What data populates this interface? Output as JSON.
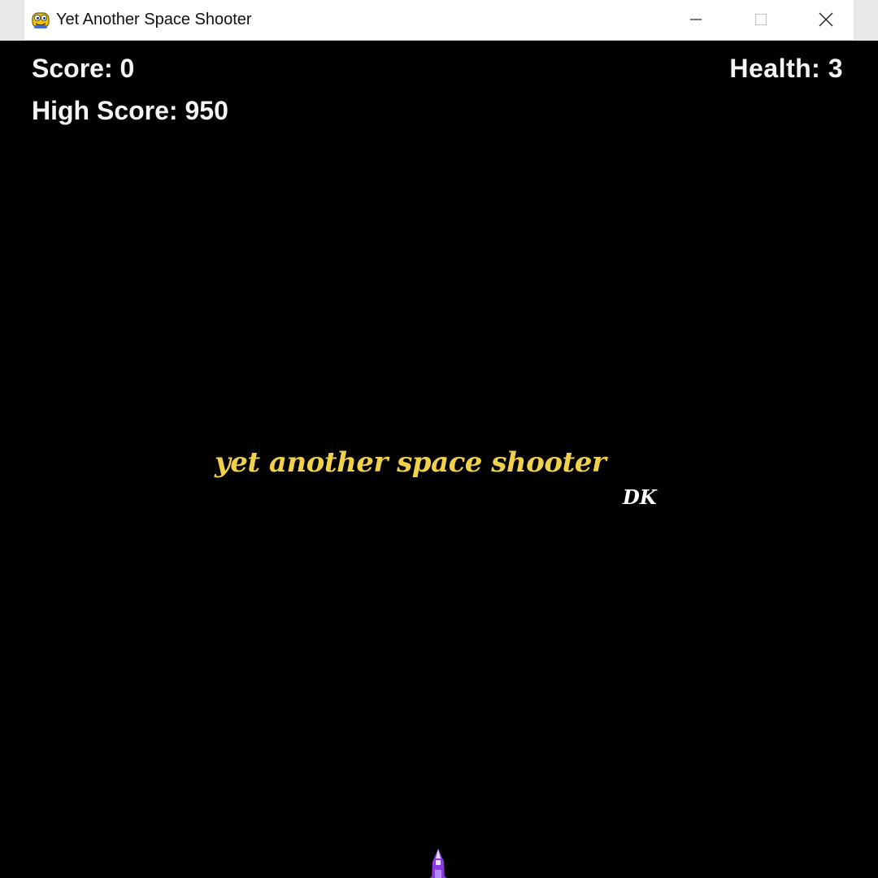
{
  "window": {
    "title": "Yet Another Space Shooter",
    "icon": "pygame-snake-icon",
    "controls": [
      "minimize-icon",
      "maximize-icon",
      "close-icon"
    ]
  },
  "hud": {
    "score": "Score: 0",
    "high_score": "High Score: 950",
    "health": "Health: 3"
  },
  "splash": {
    "title": "yet another space shooter",
    "credit": "DK"
  },
  "player": {
    "sprite": "purple-spaceship-icon"
  },
  "colors": {
    "background": "#000000",
    "hud_text": "#f4f4f4",
    "title_text": "#f2d14a",
    "credit_text": "#ffffff",
    "ship_primary": "#8a3be0"
  }
}
